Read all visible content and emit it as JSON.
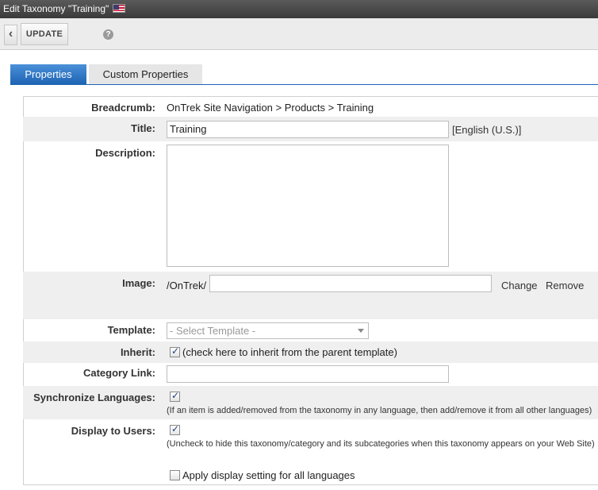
{
  "window": {
    "title": "Edit Taxonomy  \"Training\"",
    "flag_icon": "us-flag-icon"
  },
  "toolbar": {
    "back_icon": "chevron-left-icon",
    "update_label": "UPDATE",
    "help_icon": "help-icon"
  },
  "tabs": [
    {
      "label": "Properties",
      "active": true
    },
    {
      "label": "Custom Properties",
      "active": false
    }
  ],
  "form": {
    "breadcrumb": {
      "label": "Breadcrumb:",
      "value": "OnTrek Site Navigation > Products > Training"
    },
    "title": {
      "label": "Title:",
      "value": "Training",
      "language": "[English (U.S.)]"
    },
    "description": {
      "label": "Description:",
      "value": ""
    },
    "image": {
      "label": "Image:",
      "path_prefix": "/OnTrek/",
      "value": "",
      "change_label": "Change",
      "remove_label": "Remove"
    },
    "template": {
      "label": "Template:",
      "placeholder": "- Select Template -"
    },
    "inherit": {
      "label": "Inherit:",
      "checked": true,
      "text": "(check here to inherit from the parent template)"
    },
    "category_link": {
      "label": "Category Link:",
      "value": ""
    },
    "synchronize": {
      "label": "Synchronize Languages:",
      "checked": true,
      "note": "(If an item is added/removed from the taxonomy in any language, then add/remove it from all other languages)"
    },
    "display": {
      "label": "Display to Users:",
      "checked": true,
      "note": "(Uncheck to hide this taxonomy/category and its subcategories when this taxonomy appears on your Web Site)",
      "apply_all_label": "Apply display setting for all languages",
      "apply_all_checked": false
    }
  },
  "colors": {
    "tab_active": "#1e64b4",
    "row_shade": "#efefef"
  }
}
